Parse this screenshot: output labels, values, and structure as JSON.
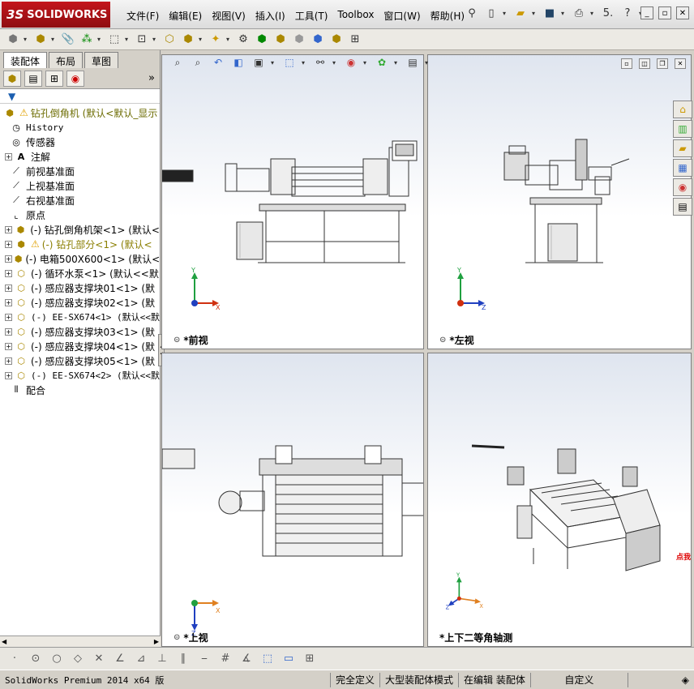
{
  "app": {
    "logo_text": "SOLIDWORKS",
    "logo_mark": "3S"
  },
  "menu": [
    "文件(F)",
    "编辑(E)",
    "视图(V)",
    "插入(I)",
    "工具(T)",
    "Toolbox",
    "窗口(W)",
    "帮助(H)"
  ],
  "top_tools_extra": "5.",
  "panel": {
    "tabs": [
      "装配体",
      "布局",
      "草图"
    ],
    "tree": [
      {
        "label": "钻孔倒角机  (默认<默认_显示",
        "kind": "root",
        "warn": true
      },
      {
        "label": "History",
        "kind": "history"
      },
      {
        "label": "传感器",
        "kind": "sensor"
      },
      {
        "label": "注解",
        "kind": "annot",
        "expand": true
      },
      {
        "label": "前视基准面",
        "kind": "plane"
      },
      {
        "label": "上视基准面",
        "kind": "plane"
      },
      {
        "label": "右视基准面",
        "kind": "plane"
      },
      {
        "label": "原点",
        "kind": "origin"
      },
      {
        "label": "(-) 钻孔倒角机架<1> (默认<",
        "kind": "part",
        "expand": true
      },
      {
        "label": "(-) 钻孔部分<1> (默认<",
        "kind": "part",
        "expand": true,
        "warn": true,
        "olive": true
      },
      {
        "label": "(-) 电箱500X600<1> (默认<",
        "kind": "part",
        "expand": true
      },
      {
        "label": "(-) 循环水泵<1> (默认<<默",
        "kind": "part",
        "expand": true
      },
      {
        "label": "(-) 感应器支撑块01<1> (默",
        "kind": "part",
        "expand": true
      },
      {
        "label": "(-) 感应器支撑块02<1> (默",
        "kind": "part",
        "expand": true
      },
      {
        "label": "(-) EE-SX674<1> (默认<<默",
        "kind": "part",
        "expand": true,
        "mono": true
      },
      {
        "label": "(-) 感应器支撑块03<1> (默",
        "kind": "part",
        "expand": true
      },
      {
        "label": "(-) 感应器支撑块04<1> (默",
        "kind": "part",
        "expand": true
      },
      {
        "label": "(-) 感应器支撑块05<1> (默",
        "kind": "part",
        "expand": true
      },
      {
        "label": "(-) EE-SX674<2> (默认<<默",
        "kind": "part",
        "expand": true,
        "mono": true
      },
      {
        "label": "配合",
        "kind": "mates"
      }
    ]
  },
  "viewports": {
    "front": "*前视",
    "left": "*左视",
    "top": "*上视",
    "iso": "*上下二等角轴测"
  },
  "axes": {
    "x": "X",
    "y": "Y",
    "z": "Z"
  },
  "status": {
    "version": "SolidWorks Premium 2014 x64 版",
    "state": "完全定义",
    "mode": "大型装配体模式",
    "editing": "在编辑 装配体",
    "units": "自定义"
  },
  "promo_text": "点我",
  "colors": {
    "logo_red": "#c4161c",
    "x_axis": "#d03010",
    "y_axis": "#20a040",
    "z_axis": "#2040c0"
  }
}
